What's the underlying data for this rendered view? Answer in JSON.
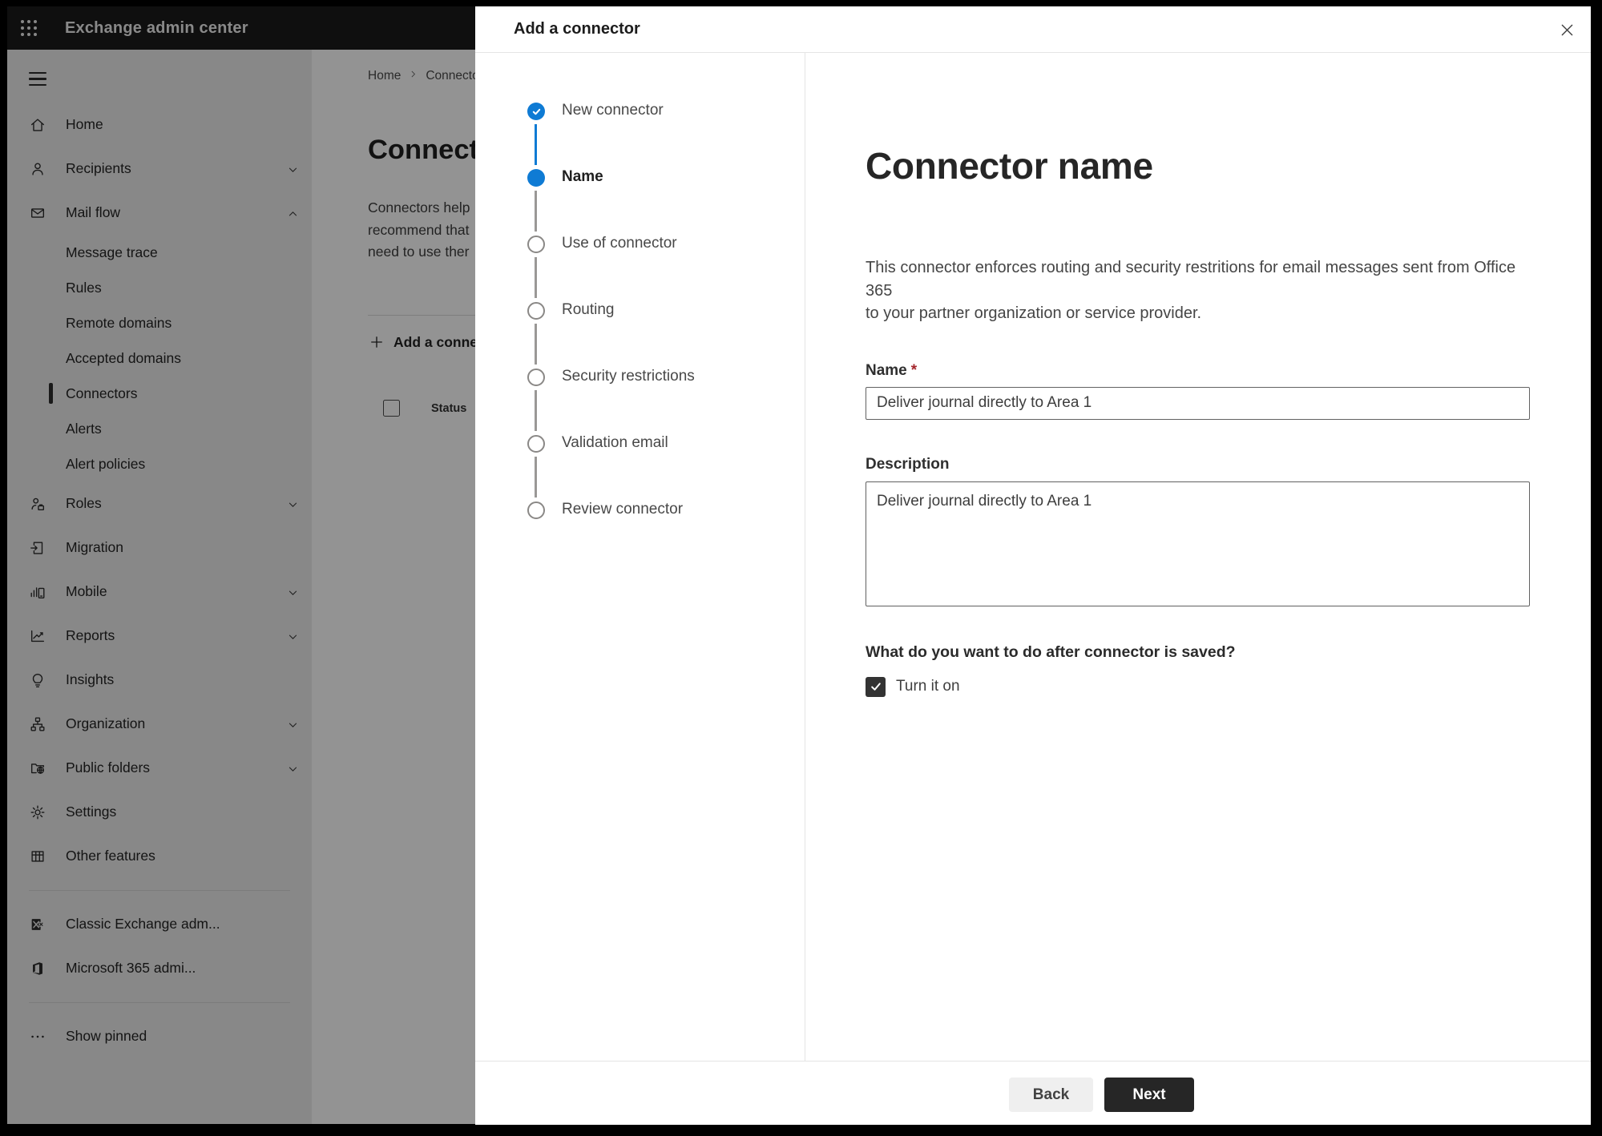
{
  "colors": {
    "accent": "#0f7bd4",
    "danger": "#a4262c",
    "topbar": "#1b1b1b",
    "btn-dark": "#262626"
  },
  "topbar": {
    "title": "Exchange admin center",
    "app_launcher_icon": "app-launcher-icon"
  },
  "sidebar": {
    "items": [
      {
        "label": "Home",
        "icon": "home-icon"
      },
      {
        "label": "Recipients",
        "icon": "person-icon",
        "chevron": "down"
      },
      {
        "label": "Mail flow",
        "icon": "envelope-icon",
        "chevron": "up",
        "expanded": true
      },
      {
        "label": "Message trace",
        "sub": true
      },
      {
        "label": "Rules",
        "sub": true
      },
      {
        "label": "Remote domains",
        "sub": true
      },
      {
        "label": "Accepted domains",
        "sub": true
      },
      {
        "label": "Connectors",
        "sub": true,
        "selected": true
      },
      {
        "label": "Alerts",
        "sub": true
      },
      {
        "label": "Alert policies",
        "sub": true
      },
      {
        "label": "Roles",
        "icon": "person-badge-icon",
        "chevron": "down"
      },
      {
        "label": "Migration",
        "icon": "document-arrow-icon"
      },
      {
        "label": "Mobile",
        "icon": "mobile-chart-icon",
        "chevron": "down"
      },
      {
        "label": "Reports",
        "icon": "line-chart-icon",
        "chevron": "down"
      },
      {
        "label": "Insights",
        "icon": "lightbulb-icon"
      },
      {
        "label": "Organization",
        "icon": "org-chart-icon",
        "chevron": "down"
      },
      {
        "label": "Public folders",
        "icon": "folder-globe-icon",
        "chevron": "down"
      },
      {
        "label": "Settings",
        "icon": "gear-icon"
      },
      {
        "label": "Other features",
        "icon": "table-grid-icon"
      },
      {
        "label": "Classic Exchange adm...",
        "icon": "classic-exchange-icon"
      },
      {
        "label": "Microsoft 365 admi...",
        "icon": "office-365-icon"
      },
      {
        "label": "Show pinned",
        "icon": "ellipsis-icon"
      }
    ]
  },
  "background_page": {
    "breadcrumb": {
      "home": "Home",
      "current": "Connectors"
    },
    "title": "Connectors",
    "intro_lines": [
      "Connectors help",
      "recommend that",
      "need to use ther"
    ],
    "add_button": "Add a connector",
    "table": {
      "status_header": "Status"
    }
  },
  "modal": {
    "title": "Add a connector",
    "close_icon": "close-icon",
    "steps": [
      {
        "label": "New connector",
        "state": "complete"
      },
      {
        "label": "Name",
        "state": "current"
      },
      {
        "label": "Use of connector",
        "state": "upcoming"
      },
      {
        "label": "Routing",
        "state": "upcoming"
      },
      {
        "label": "Security restrictions",
        "state": "upcoming"
      },
      {
        "label": "Validation email",
        "state": "upcoming"
      },
      {
        "label": "Review connector",
        "state": "upcoming"
      }
    ],
    "content": {
      "heading": "Connector name",
      "description_lines": [
        "This connector enforces routing and security restritions for email messages sent from Office 365",
        "to your partner organization or service provider."
      ],
      "name_label": "Name",
      "required_marker": "*",
      "name_value": "Deliver journal directly to Area 1",
      "description_label": "Description",
      "description_value": "Deliver journal directly to Area 1",
      "question": "What do you want to do after connector is saved?",
      "checkbox_label": "Turn it on",
      "checkbox_checked": true
    },
    "footer": {
      "back_label": "Back",
      "next_label": "Next"
    }
  }
}
